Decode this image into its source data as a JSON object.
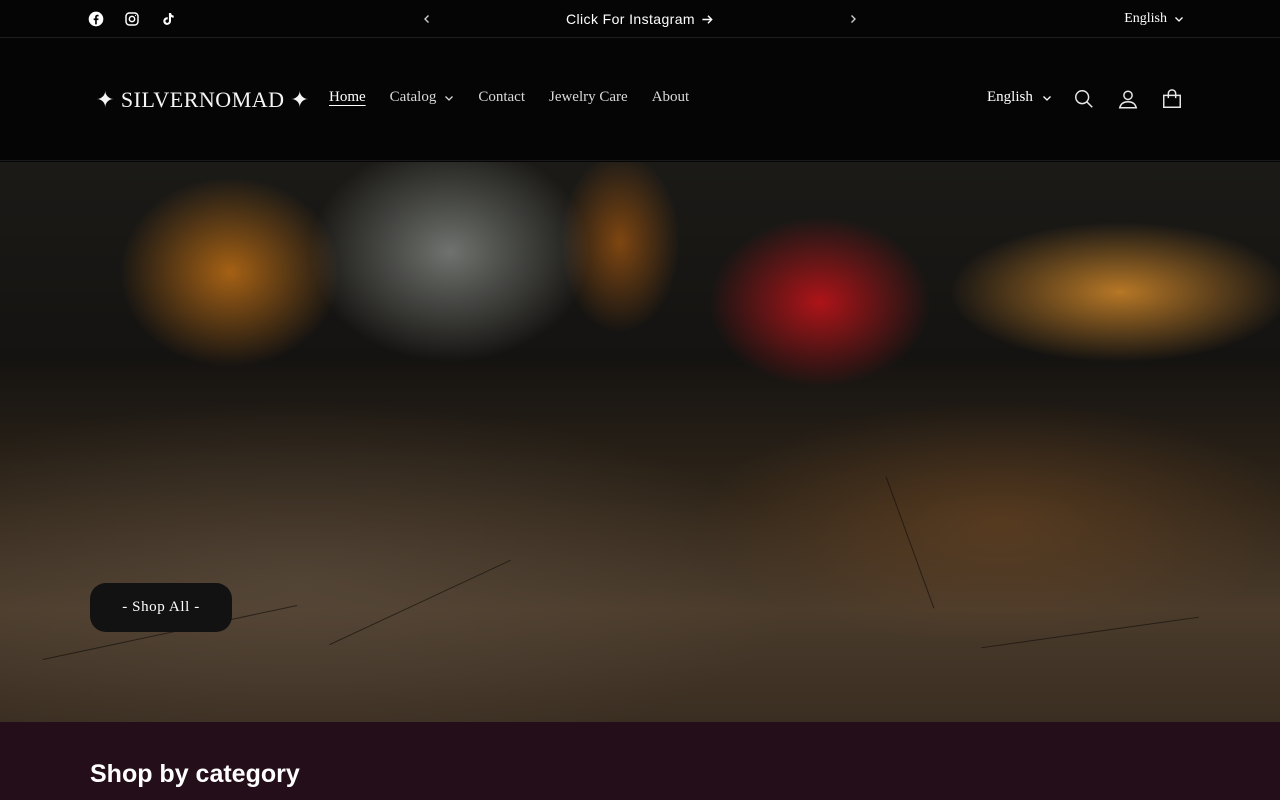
{
  "announcement": {
    "text": "Click For Instagram",
    "language": "English"
  },
  "social": [
    "facebook-icon",
    "instagram-icon",
    "tiktok-icon"
  ],
  "header": {
    "logo": "✦ SILVERNOMAD ✦",
    "nav": [
      {
        "label": "Home",
        "active": true
      },
      {
        "label": "Catalog",
        "dropdown": true
      },
      {
        "label": "Contact"
      },
      {
        "label": "Jewelry Care"
      },
      {
        "label": "About"
      }
    ],
    "language": "English"
  },
  "hero": {
    "button_label": "- Shop All -"
  },
  "category": {
    "title": "Shop by category"
  },
  "colors": {
    "background": "#050505",
    "category_bg": "#240e1a",
    "button_bg": "#121212"
  }
}
